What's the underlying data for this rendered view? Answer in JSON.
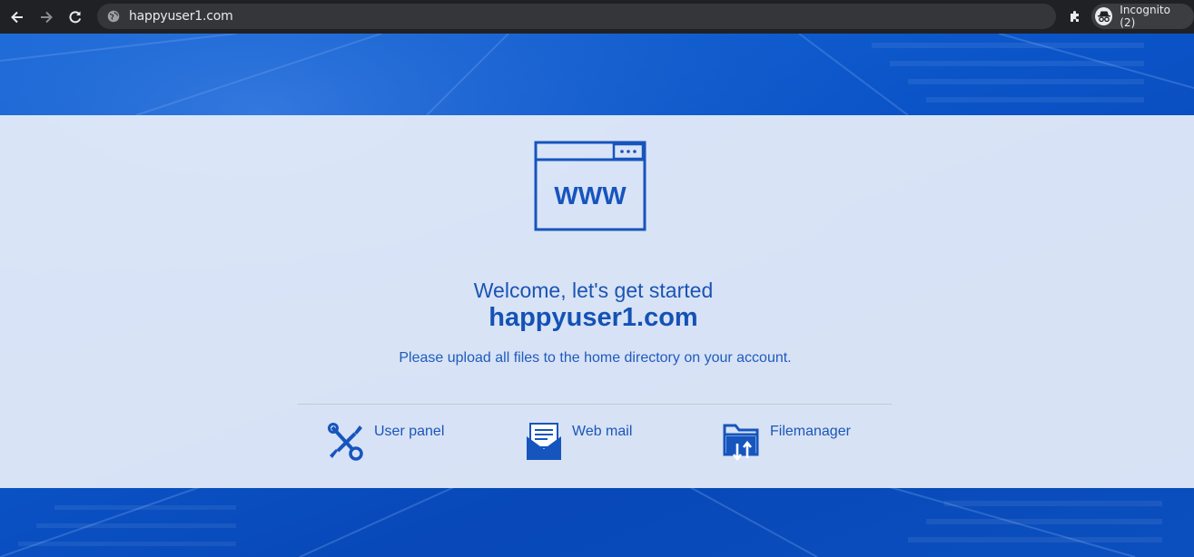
{
  "browser": {
    "url": "happyuser1.com",
    "incognito_label": "Incognito (2)"
  },
  "content": {
    "welcome": "Welcome, let's get started",
    "domain": "happyuser1.com",
    "instructions": "Please upload all files to the home directory on your account.",
    "www_label": "WWW"
  },
  "links": [
    {
      "label": "User panel",
      "icon": "tools-icon"
    },
    {
      "label": "Web mail",
      "icon": "mail-icon"
    },
    {
      "label": "Filemanager",
      "icon": "folder-transfer-icon"
    }
  ],
  "colors": {
    "brand_blue": "#1452b5",
    "chrome_bg": "#202124"
  }
}
